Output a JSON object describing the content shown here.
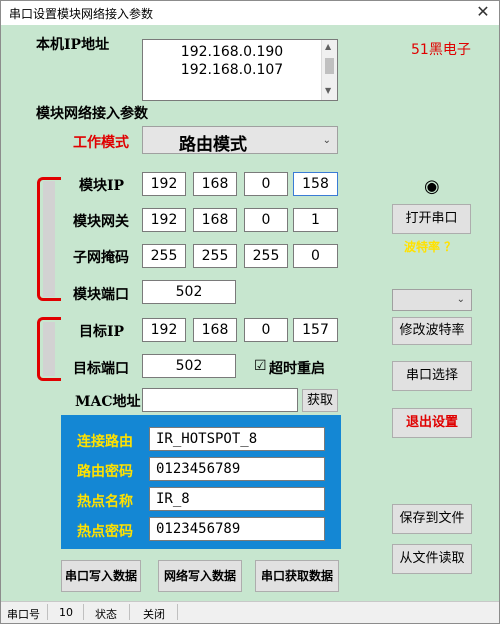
{
  "window": {
    "title": "串口设置模块网络接入参数",
    "close_glyph": "✕"
  },
  "local_ip": {
    "label": "本机IP地址",
    "addresses": [
      "192.168.0.190",
      "192.168.0.107"
    ]
  },
  "brand": "51黑电子",
  "module_section": {
    "title": "模块网络接入参数",
    "mode_label": "工作模式",
    "mode_value": "路由模式",
    "module_ip_label": "模块IP",
    "module_ip": [
      "192",
      "168",
      "0",
      "158"
    ],
    "gateway_label": "模块网关",
    "gateway": [
      "192",
      "168",
      "0",
      "1"
    ],
    "subnet_label": "子网掩码",
    "subnet": [
      "255",
      "255",
      "255",
      "0"
    ],
    "module_port_label": "模块端口",
    "module_port": "502",
    "target_ip_label": "目标IP",
    "target_ip": [
      "192",
      "168",
      "0",
      "157"
    ],
    "target_port_label": "目标端口",
    "target_port": "502",
    "timeout_label": "超时重启",
    "timeout_checked": true,
    "mac_label": "MAC地址",
    "mac_value": "",
    "get_button": "获取"
  },
  "wifi": {
    "router_label": "连接路由",
    "router_value": "IR_HOTSPOT_8",
    "router_pwd_label": "路由密码",
    "router_pwd_value": "0123456789",
    "hotspot_label": "热点名称",
    "hotspot_value": "IR_8",
    "hotspot_pwd_label": "热点密码",
    "hotspot_pwd_value": "0123456789"
  },
  "right_panel": {
    "radio_glyph": "◉",
    "open_port": "打开串口",
    "baud_label": "波特率 ？",
    "baud_select_value": "",
    "change_baud": "修改波特率",
    "port_select": "串口选择",
    "exit_settings": "退出设置",
    "save_file": "保存到文件",
    "load_file": "从文件读取"
  },
  "bottom_buttons": {
    "serial_write": "串口写入数据",
    "net_write": "网络写入数据",
    "serial_read": "串口获取数据"
  },
  "status": {
    "port_label": "串口号",
    "port_value": "10",
    "state_label": "状态",
    "state_value": "关闭"
  },
  "colors": {
    "background": "#c7e6cf",
    "accent_red": "#e00000",
    "panel_blue": "#1487d4",
    "panel_label_yellow": "#ffe100"
  }
}
